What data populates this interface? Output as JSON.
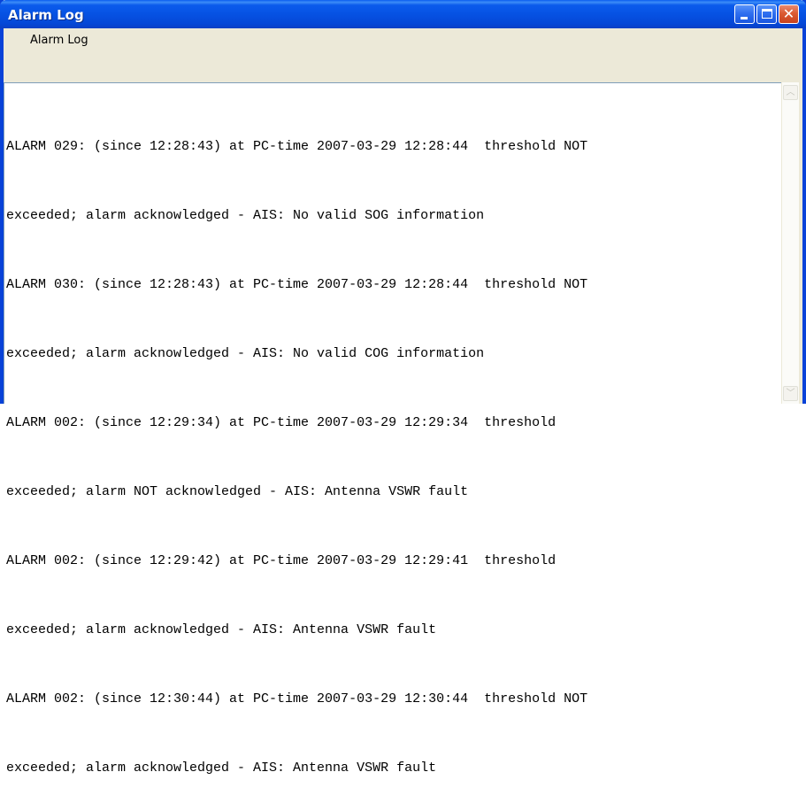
{
  "window": {
    "title": "Alarm Log",
    "controls": {
      "minimize_icon": "minimize-icon",
      "maximize_icon": "maximize-icon",
      "close_icon": "close-icon",
      "close_glyph": "✕"
    }
  },
  "menu": {
    "items": [
      {
        "label": "Alarm Log"
      }
    ]
  },
  "log": {
    "lines": [
      "ALARM 029: (since 12:28:43) at PC-time 2007-03-29 12:28:44  threshold NOT",
      "exceeded; alarm acknowledged - AIS: No valid SOG information",
      "ALARM 030: (since 12:28:43) at PC-time 2007-03-29 12:28:44  threshold NOT",
      "exceeded; alarm acknowledged - AIS: No valid COG information",
      "ALARM 002: (since 12:29:34) at PC-time 2007-03-29 12:29:34  threshold",
      "exceeded; alarm NOT acknowledged - AIS: Antenna VSWR fault",
      "ALARM 002: (since 12:29:42) at PC-time 2007-03-29 12:29:41  threshold",
      "exceeded; alarm acknowledged - AIS: Antenna VSWR fault",
      "ALARM 002: (since 12:30:44) at PC-time 2007-03-29 12:30:44  threshold NOT",
      "exceeded; alarm acknowledged - AIS: Antenna VSWR fault"
    ]
  },
  "scrollbar": {
    "up_glyph": "︿",
    "down_glyph": "﹀"
  },
  "colors": {
    "titlebar": "#0652e3",
    "window_face": "#ece9d8",
    "close_button": "#db5b33"
  }
}
